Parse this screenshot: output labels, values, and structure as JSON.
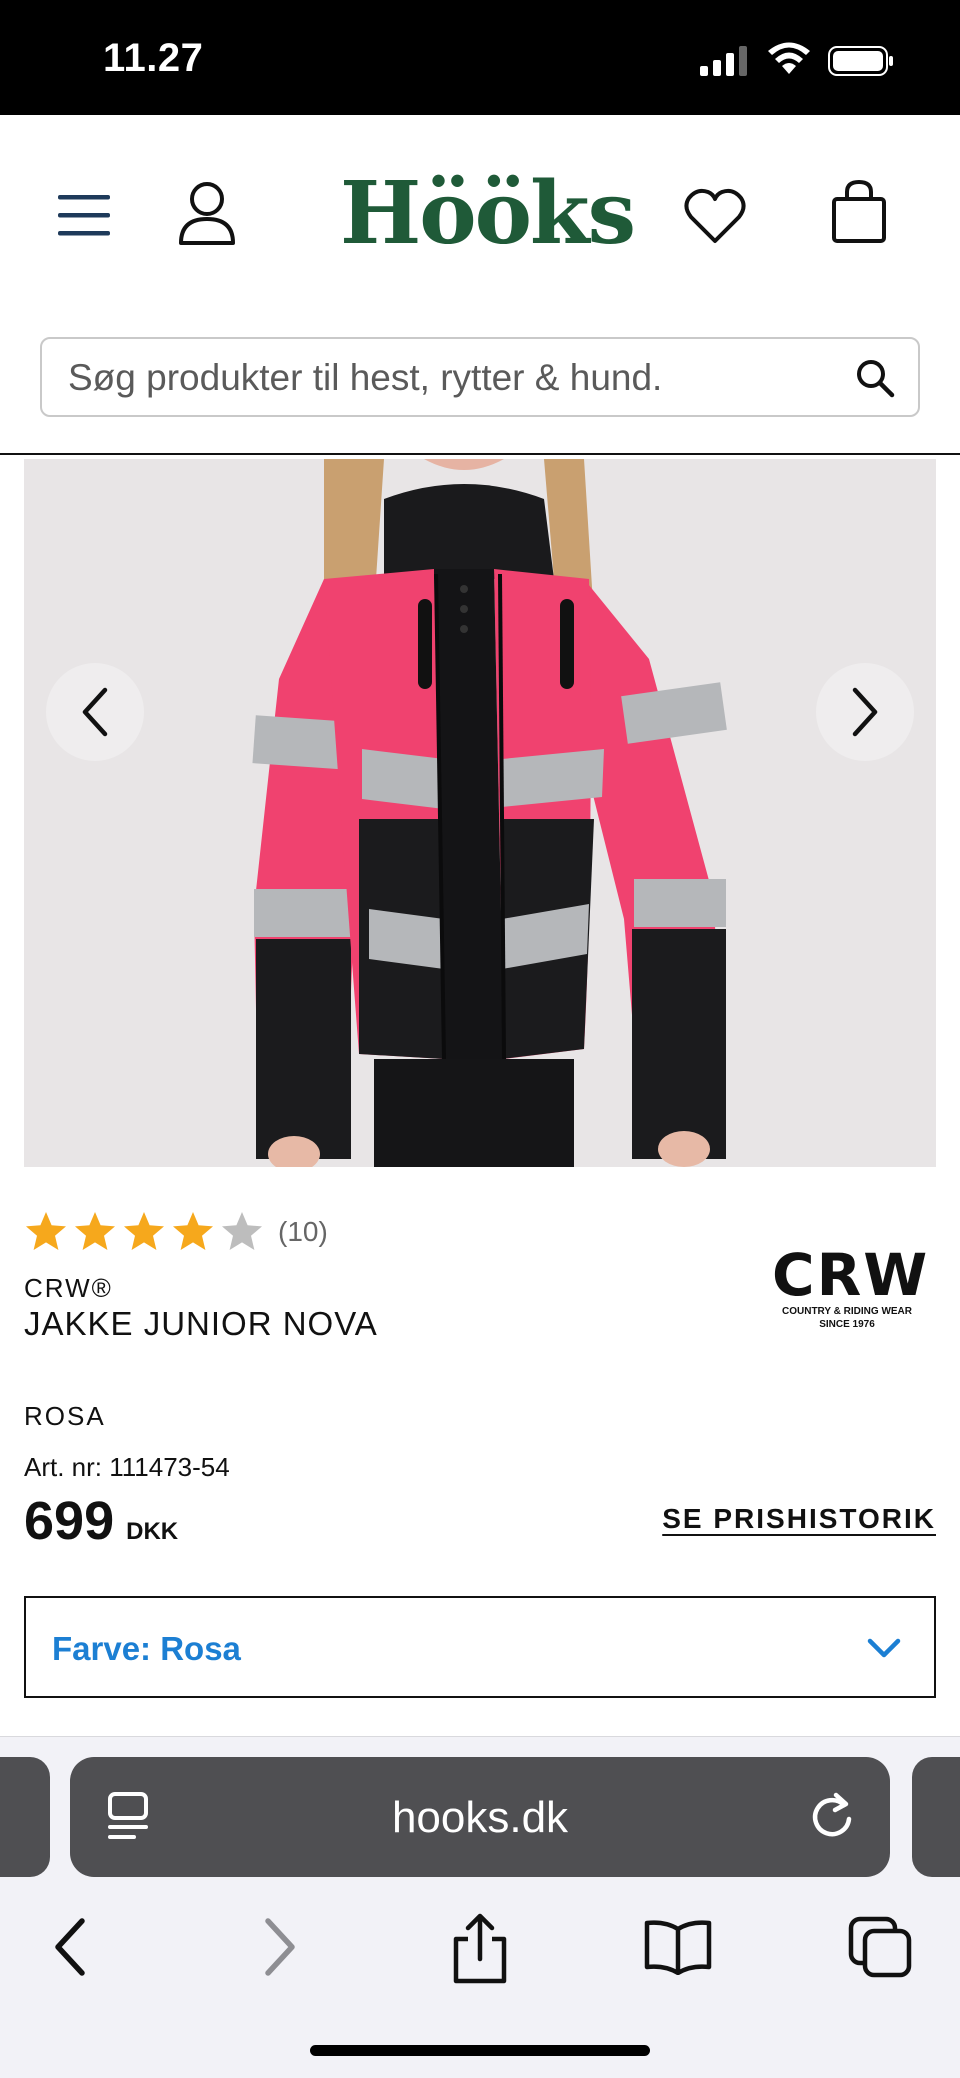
{
  "status_bar": {
    "time": "11.27",
    "icons": [
      "cellular-signal-icon",
      "wifi-icon",
      "battery-icon"
    ]
  },
  "header": {
    "logo": "Hööks",
    "logo_color": "#1f5a38",
    "icons": [
      "menu-icon",
      "account-icon",
      "heart-icon",
      "bag-icon"
    ],
    "search": {
      "placeholder": "Søg produkter til hest, rytter & hund.",
      "icon": "search-icon"
    }
  },
  "gallery": {
    "image": "girl-wearing-pink-black-reflective-jacket",
    "prev_icon": "chevron-left-icon",
    "next_icon": "chevron-right-icon"
  },
  "product": {
    "rating": {
      "stars": 4,
      "max": 5,
      "count_text": "(10)"
    },
    "brand": "CRW®",
    "title": "JAKKE JUNIOR NOVA",
    "brand_logo": {
      "name": "CRW",
      "line1": "COUNTRY & RIDING WEAR",
      "line2": "SINCE 1976"
    },
    "color_name": "ROSA",
    "art_nr": "Art. nr: 111473-54",
    "price": "699",
    "currency": "DKK",
    "price_history_link": "SE PRISHISTORIK",
    "color_select": {
      "label": "Farve: Rosa",
      "icon": "chevron-down-icon",
      "accent": "#1c7fd3"
    }
  },
  "browser": {
    "url": "hooks.dk",
    "icons": [
      "reader-icon",
      "reload-icon",
      "back-icon",
      "forward-icon",
      "share-icon",
      "bookmarks-icon",
      "tabs-icon"
    ]
  },
  "colors": {
    "star": "#f6a81c",
    "star_empty": "#bdbdbd",
    "jacket_pink": "#f0426f"
  }
}
